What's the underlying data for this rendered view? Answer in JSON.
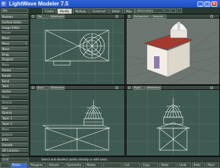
{
  "window": {
    "title": "LightWave Modeler 7.5",
    "minimize": "_",
    "maximize": "□",
    "close": "×"
  },
  "menu": {
    "file": "File",
    "tabs": [
      "Create",
      "Modify",
      "Multiply",
      "Construct",
      "Detail",
      "Map",
      "Display"
    ],
    "active_tab": "Modify",
    "observatory": "observatory",
    "layer_boxes": [
      "",
      "",
      ""
    ]
  },
  "toolbar": {
    "items": [
      {
        "label": "Modeler",
        "key": "",
        "head": false
      },
      {
        "label": "Surface Editor",
        "key": "",
        "head": false
      },
      {
        "label": "Image Editor",
        "key": "",
        "head": false
      },
      {
        "label": "Primer",
        "key": "",
        "head": true
      },
      {
        "label": "Move",
        "key": "",
        "head": false
      },
      {
        "label": "Move",
        "key": "t",
        "head": false
      },
      {
        "label": "Move",
        "key": "",
        "head": false
      },
      {
        "label": "Drag",
        "key": "",
        "head": false
      },
      {
        "label": "Dragnet",
        "key": "",
        "head": false
      },
      {
        "label": "More",
        "key": "",
        "head": true
      },
      {
        "label": "Rotate",
        "key": "",
        "head": false
      },
      {
        "label": "Rotate",
        "key": "",
        "head": false
      },
      {
        "label": "Bend",
        "key": "",
        "head": false
      },
      {
        "label": "Twist",
        "key": "",
        "head": false
      },
      {
        "label": "Vortex",
        "key": "",
        "head": false
      },
      {
        "label": "More",
        "key": "",
        "head": true
      },
      {
        "label": "Stretch",
        "key": "",
        "head": true
      },
      {
        "label": "Size",
        "key": "",
        "head": false
      },
      {
        "label": "Stretch",
        "key": "",
        "head": false
      },
      {
        "label": "Taper 1",
        "key": "",
        "head": false
      },
      {
        "label": "Taper 2",
        "key": "",
        "head": false
      },
      {
        "label": "More",
        "key": "",
        "head": true
      },
      {
        "label": "Deform",
        "key": "",
        "head": true
      },
      {
        "label": "Jitter",
        "key": "",
        "head": false
      },
      {
        "label": "Smooth",
        "key": "",
        "head": false
      },
      {
        "label": "3D Contains",
        "key": "",
        "head": false
      },
      {
        "label": "More",
        "key": "",
        "head": true
      }
    ]
  },
  "viewports": {
    "top": {
      "view": "Top",
      "mode": "Wireframe"
    },
    "perspective": {
      "view": "Perspective",
      "mode": "Textured"
    },
    "back": {
      "view": "Back",
      "mode": "Wireframe"
    },
    "right": {
      "view": "Right",
      "mode": "Wireframe"
    }
  },
  "status": {
    "text": "Select and deselect points directly or with lasso.",
    "grid": "Grid"
  },
  "bottombar": [
    "Points",
    "Polygons",
    "Volume",
    "Symmetry",
    "Modes",
    "",
    "Cut",
    "Copy",
    "Paste",
    "Undo",
    "Redo",
    "More"
  ],
  "bottom_selected": "Points",
  "colors": {
    "accent": "#2f63d8",
    "wire": "#ffffff",
    "grid": "#5a766c",
    "roof": "#a33a2e",
    "wall": "#ece7dd"
  }
}
